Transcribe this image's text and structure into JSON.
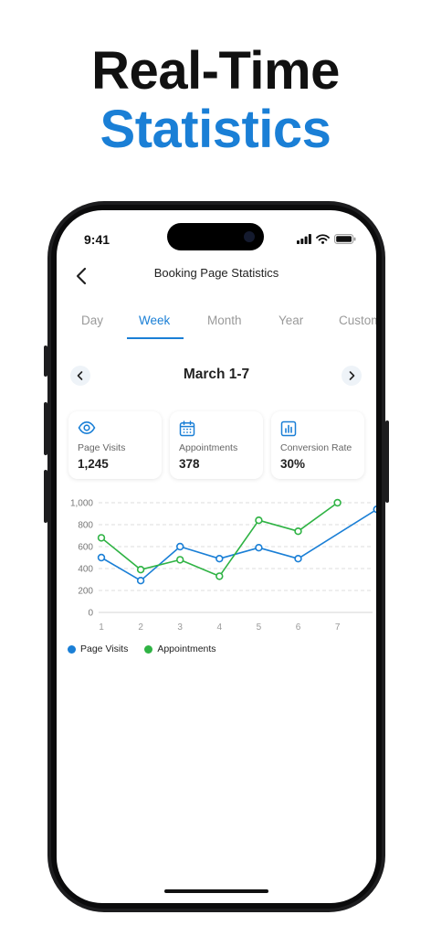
{
  "hero": {
    "line1": "Real-Time",
    "line2": "Statistics"
  },
  "status_bar": {
    "time": "9:41"
  },
  "nav": {
    "title": "Booking Page Statistics",
    "back_icon": "chevron-left-icon"
  },
  "tabs": [
    "Day",
    "Week",
    "Month",
    "Year",
    "Custom"
  ],
  "active_tab": "Week",
  "date_range": {
    "label": "March 1-7",
    "prev_icon": "chevron-left-icon",
    "next_icon": "chevron-right-icon"
  },
  "stats": [
    {
      "label": "Page Visits",
      "value": "1,245",
      "icon": "eye-icon"
    },
    {
      "label": "Appointments",
      "value": "378",
      "icon": "calendar-icon"
    },
    {
      "label": "Conversion Rate",
      "value": "30%",
      "icon": "bar-chart-icon"
    }
  ],
  "colors": {
    "accent": "#1a7fd6",
    "appointments": "#2fb344",
    "page_visits": "#1a7fd6"
  },
  "chart_data": {
    "type": "line",
    "x": [
      1,
      2,
      3,
      4,
      5,
      6,
      7,
      8
    ],
    "x_tick_labels": [
      "1",
      "2",
      "3",
      "4",
      "5",
      "6",
      "7"
    ],
    "y_tick_labels": [
      "0",
      "200",
      "400",
      "600",
      "800",
      "1,000"
    ],
    "ylim": [
      0,
      1000
    ],
    "grid": "horizontal-dashed",
    "legend": "bottom-left",
    "series": [
      {
        "name": "Page Visits",
        "color": "#1a7fd6",
        "values": [
          500,
          290,
          600,
          490,
          590,
          490,
          null,
          940
        ]
      },
      {
        "name": "Appointments",
        "color": "#2fb344",
        "values": [
          680,
          390,
          480,
          330,
          840,
          740,
          1000,
          null
        ]
      }
    ]
  }
}
